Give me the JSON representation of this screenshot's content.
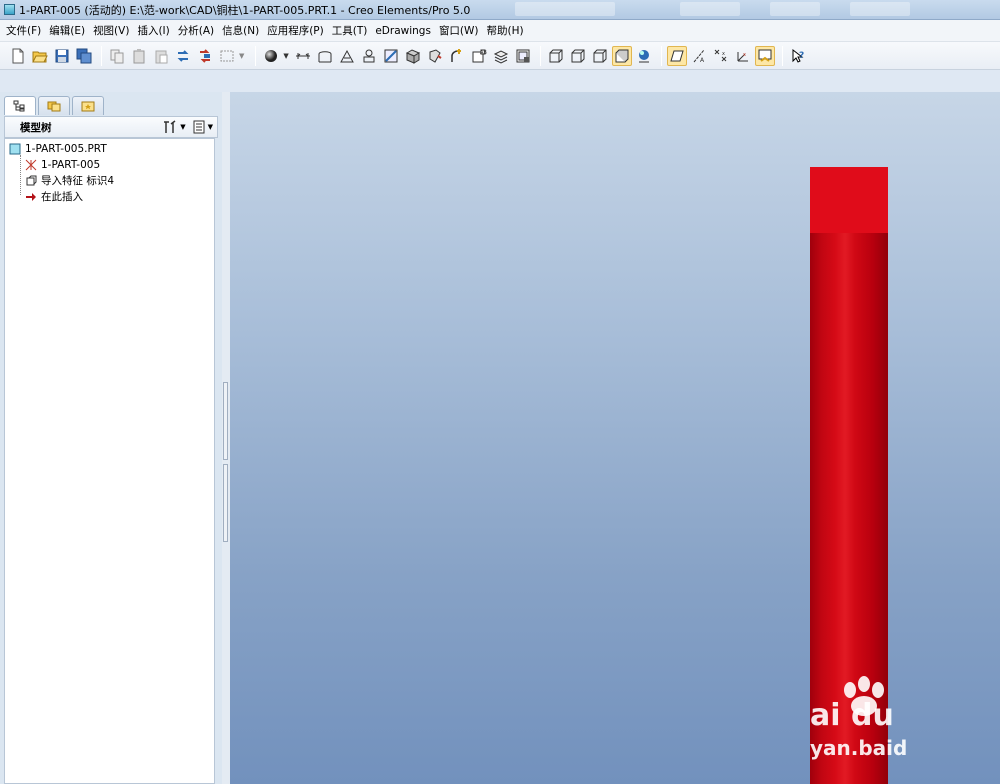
{
  "window": {
    "title": "1-PART-005 (活动的) E:\\范-work\\CAD\\铜柱\\1-PART-005.PRT.1 - Creo Elements/Pro 5.0"
  },
  "menu": {
    "items": [
      "文件(F)",
      "编辑(E)",
      "视图(V)",
      "插入(I)",
      "分析(A)",
      "信息(N)",
      "应用程序(P)",
      "工具(T)",
      "eDrawings",
      "窗口(W)",
      "帮助(H)"
    ]
  },
  "toolbar": {
    "icons": [
      "new-icon",
      "open-icon",
      "save-icon",
      "save-copy-icon",
      "copy-icon",
      "paste-icon",
      "paste-special-icon",
      "regenerate-icon",
      "regen-manager-icon",
      "select-box-icon",
      "shade-sphere-icon",
      "datum-plane-icon",
      "datum-axis-icon",
      "datum-point-icon",
      "datum-csys-icon",
      "sketch-icon",
      "extrude-icon",
      "revolve-icon",
      "round-icon",
      "chamfer-icon",
      "layer-icon",
      "view-manager-icon",
      "wireframe-icon",
      "hidden-line-icon",
      "no-hidden-icon",
      "shaded-icon",
      "enhanced-realism-icon",
      "plane-display-icon",
      "axis-display-icon",
      "point-display-icon",
      "csys-display-icon",
      "annotation-display-icon",
      "context-help-icon"
    ]
  },
  "left_panel": {
    "pane_title": "模型树",
    "tree": [
      {
        "label": "1-PART-005.PRT",
        "icon": "part-icon"
      },
      {
        "label": "1-PART-005",
        "icon": "csys-icon"
      },
      {
        "label": "导入特征 标识4",
        "icon": "import-feature-icon"
      },
      {
        "label": "在此插入",
        "icon": "insert-here-arrow-icon"
      }
    ]
  },
  "graphics": {
    "model_color": "#e00c1a",
    "background_top": "#c7d6e7",
    "background_bottom": "#7291bd"
  },
  "watermark": {
    "line1": "ai du",
    "line2": "yan.baid"
  }
}
